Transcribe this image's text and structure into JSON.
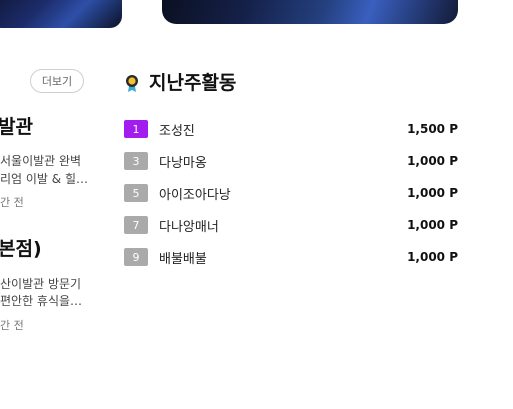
{
  "left_panel": {
    "more_label": "더보기",
    "posts": [
      {
        "title": "발관",
        "desc_line1": "서울이발관 완벽",
        "desc_line2": "리엄 이발 & 힐…",
        "time": "간 전"
      },
      {
        "title": "본점)",
        "desc_line1": "산이발관 방문기",
        "desc_line2": "편안한 휴식을…",
        "time": "간 전"
      }
    ]
  },
  "ranking": {
    "title": "지난주활동",
    "icon": "medal-icon",
    "accent_color": "#a21cf0",
    "items": [
      {
        "rank": "1",
        "name": "조성진",
        "points": "1,500 P"
      },
      {
        "rank": "3",
        "name": "다낭마옹",
        "points": "1,000 P"
      },
      {
        "rank": "5",
        "name": "아이조아다낭",
        "points": "1,000 P"
      },
      {
        "rank": "7",
        "name": "다나앙매너",
        "points": "1,000 P"
      },
      {
        "rank": "9",
        "name": "배불배불",
        "points": "1,000 P"
      }
    ]
  }
}
